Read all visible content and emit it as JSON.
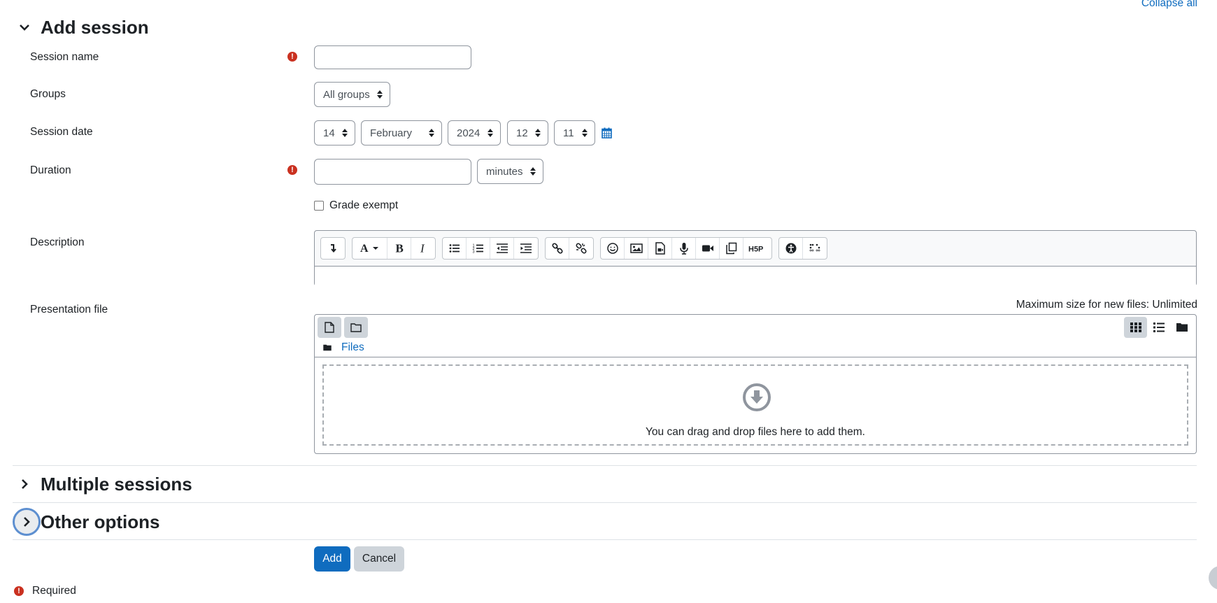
{
  "collapse_all": "Collapse all",
  "sections": {
    "add_session": "Add session",
    "multiple_sessions": "Multiple sessions",
    "other_options": "Other options"
  },
  "form": {
    "session_name": {
      "label": "Session name",
      "value": ""
    },
    "groups": {
      "label": "Groups",
      "selected": "All groups"
    },
    "session_date": {
      "label": "Session date",
      "day": "14",
      "month": "February",
      "year": "2024",
      "hour": "12",
      "minute": "11"
    },
    "duration": {
      "label": "Duration",
      "value": "",
      "unit": "minutes"
    },
    "grade_exempt": {
      "label": "Grade exempt",
      "checked": false
    },
    "description": {
      "label": "Description"
    },
    "presentation_file": {
      "label": "Presentation file",
      "max_size": "Maximum size for new files: Unlimited",
      "path_label": "Files",
      "drop_text": "You can drag and drop files here to add them."
    }
  },
  "buttons": {
    "add": "Add",
    "cancel": "Cancel"
  },
  "required_note": "Required",
  "icons": {
    "required": "exclamation-circle-icon",
    "calendar": "calendar-icon"
  },
  "colors": {
    "accent": "#0f6cbf",
    "required": "#ca3120"
  }
}
